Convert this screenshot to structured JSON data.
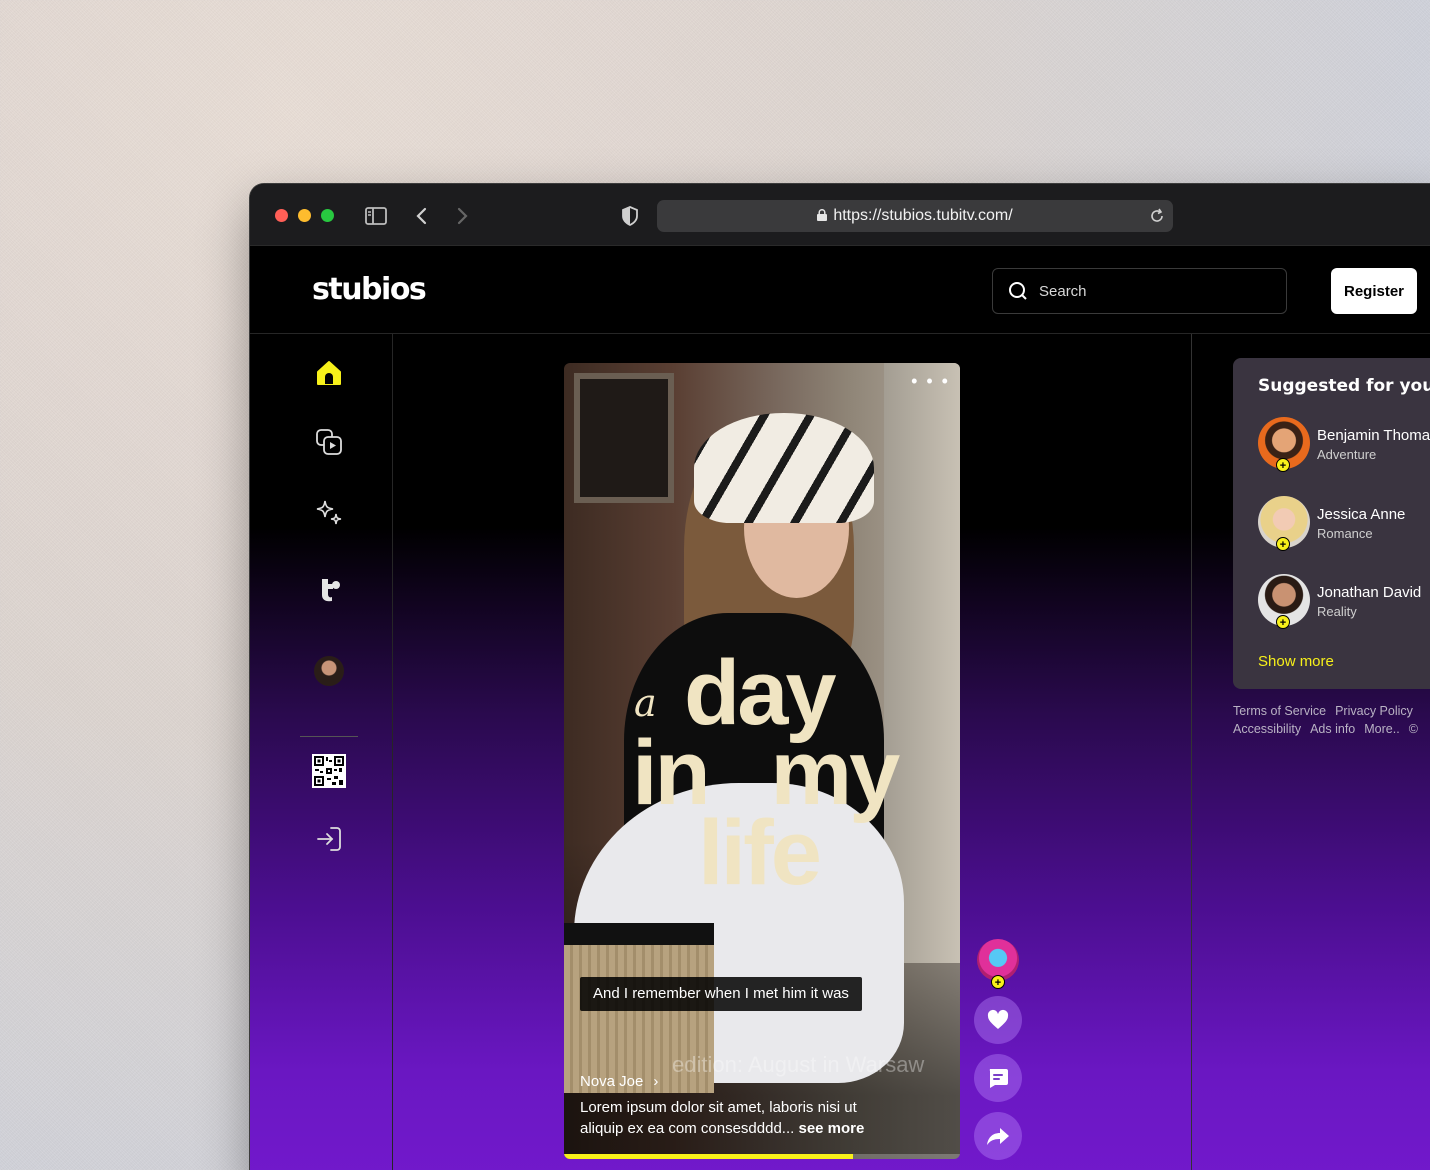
{
  "browser": {
    "url": "https://stubios.tubitv.com/"
  },
  "header": {
    "logo": "stubios",
    "search_placeholder": "Search",
    "register_label": "Register"
  },
  "sidebar": {
    "items": [
      {
        "name": "home",
        "icon": "home-icon",
        "active": true
      },
      {
        "name": "channels",
        "icon": "video-library-icon"
      },
      {
        "name": "explore",
        "icon": "sparkles-icon"
      },
      {
        "name": "tubi",
        "icon": "tubi-logo-icon"
      },
      {
        "name": "profile",
        "icon": "avatar"
      },
      {
        "name": "qr",
        "icon": "qr-code-icon"
      },
      {
        "name": "login",
        "icon": "login-icon"
      }
    ]
  },
  "video": {
    "title_a": "a",
    "title_day": "day",
    "title_in_my": "in my",
    "title_life": "life",
    "caption": "And I remember when I met him it was",
    "ghost_text": "edition: August in Warsaw",
    "author": "Nova Joe",
    "description": "Lorem ipsum dolor sit amet,  laboris nisi ut aliquip ex ea com consesdddd...",
    "see_more": "see more",
    "progress": 0.73
  },
  "suggested": {
    "title": "Suggested for you",
    "users": [
      {
        "name": "Benjamin Thomas",
        "genre": "Adventure"
      },
      {
        "name": "Jessica Anne",
        "genre": "Romance"
      },
      {
        "name": "Jonathan David",
        "genre": "Reality"
      }
    ],
    "show_more": "Show more"
  },
  "footer": {
    "links": [
      "Terms of Service",
      "Privacy Policy",
      "Accessibility",
      "Ads info",
      "More..",
      "©"
    ]
  },
  "colors": {
    "accent": "#f7f01a",
    "purple": "#6a17c2"
  }
}
